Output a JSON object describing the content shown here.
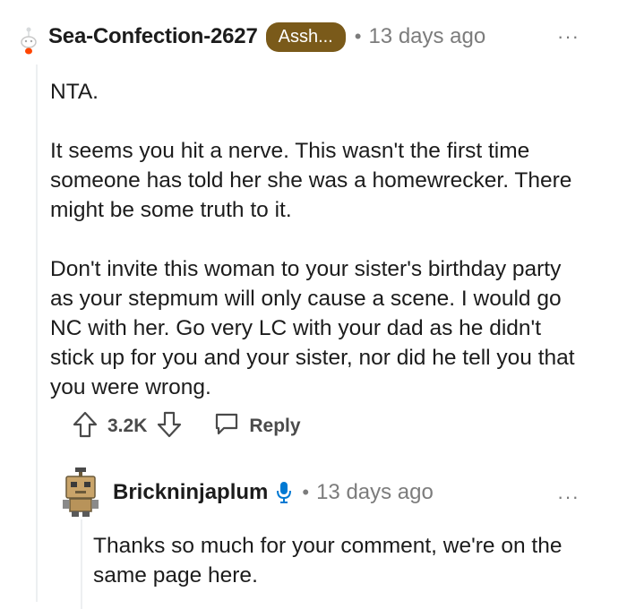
{
  "comment": {
    "username": "Sea-Confection-2627",
    "flair": "Assh...",
    "separator": "•",
    "time": "13 days ago",
    "more_label": "···",
    "paragraphs": [
      "NTA.",
      "It seems you hit a nerve. This wasn't the first time someone has told her she was a homewrecker. There might be some truth to it.",
      "Don't invite this woman to your sister's birthday party as your stepmum will only cause a scene. I would go NC with her. Go very LC with your dad as he didn't stick up for you and your sister, nor did he tell you that you were wrong."
    ],
    "actions": {
      "vote_count": "3.2K",
      "reply_label": "Reply"
    }
  },
  "reply": {
    "username": "Brickninjaplum",
    "separator": "•",
    "time": "13 days ago",
    "more_label": "···",
    "text": "Thanks so much for your comment, we're on the same page here."
  },
  "colors": {
    "flair_bg": "#7a5a1a",
    "mic_blue": "#0079d3",
    "meta_gray": "#7c7c7c"
  }
}
